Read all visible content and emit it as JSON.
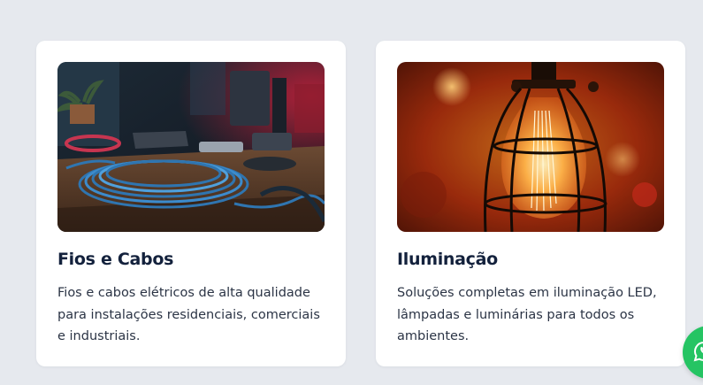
{
  "cards": [
    {
      "title": "Fios e Cabos",
      "description": "Fios e cabos elétricos de alta qualidade para instalações residenciais, comerciais e industriais.",
      "image": "cables-on-desk-photo"
    },
    {
      "title": "Iluminação",
      "description": "Soluções completas em iluminação LED, lâmpadas e luminárias para todos os ambientes.",
      "image": "caged-edison-bulb-photo"
    }
  ],
  "floating_button": {
    "icon": "whatsapp-icon",
    "color": "#25c463"
  },
  "colors": {
    "background": "#e6e9ee",
    "card": "#ffffff",
    "title": "#13213c",
    "text": "#2b3445"
  }
}
